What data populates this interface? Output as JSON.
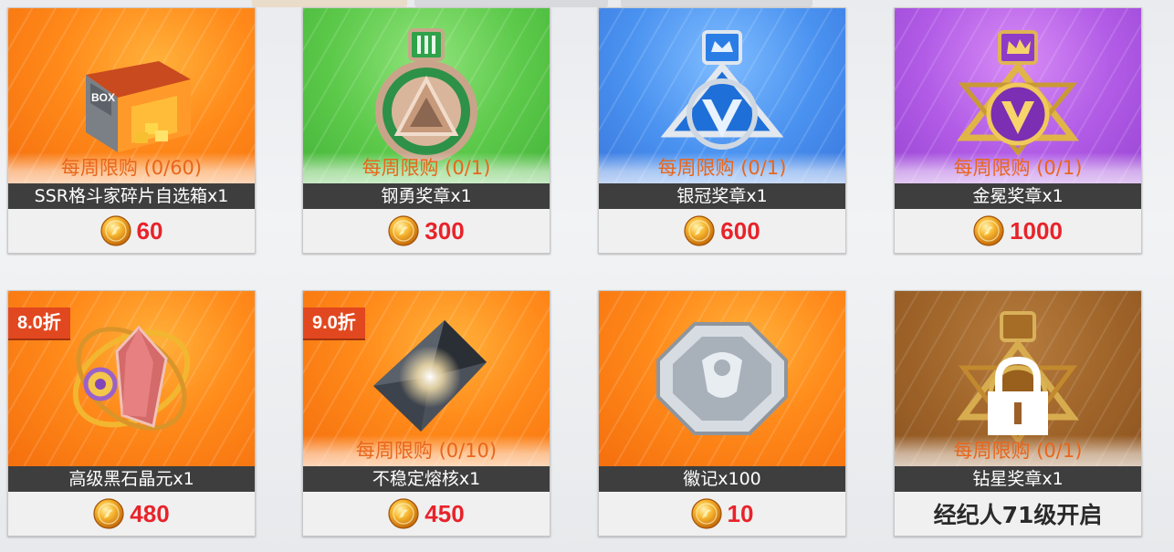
{
  "shop": {
    "items": [
      {
        "name": "SSR格斗家碎片自选箱x1",
        "limit": "每周限购 (0/60)",
        "price": "60",
        "icon": "ssr-fighter-fragment-box-icon",
        "color": "orange"
      },
      {
        "name": "钢勇奖章x1",
        "limit": "每周限购 (0/1)",
        "price": "300",
        "icon": "steel-valor-medal-icon",
        "color": "green"
      },
      {
        "name": "银冠奖章x1",
        "limit": "每周限购 (0/1)",
        "price": "600",
        "icon": "silver-crown-medal-icon",
        "color": "blue"
      },
      {
        "name": "金冕奖章x1",
        "limit": "每周限购 (0/1)",
        "price": "1000",
        "icon": "gold-crown-medal-icon",
        "color": "purple"
      },
      {
        "name": "高级黑石晶元x1",
        "discount": "8.0折",
        "price": "480",
        "icon": "black-stone-crystal-icon",
        "color": "orange"
      },
      {
        "name": "不稳定熔核x1",
        "limit": "每周限购 (0/10)",
        "discount": "9.0折",
        "price": "450",
        "icon": "unstable-core-icon",
        "color": "orange"
      },
      {
        "name": "徽记x100",
        "price": "10",
        "icon": "emblem-icon",
        "color": "orange"
      },
      {
        "name": "钻星奖章x1",
        "limit": "每周限购 (0/1)",
        "locked_text": "经纪人71级开启",
        "icon": "diamond-star-medal-icon",
        "color": "locked"
      }
    ],
    "currency_icon": "gold-coin-icon",
    "colors": {
      "price": "#e8232a",
      "limit": "#e8661c",
      "discount": "#e2481f"
    }
  }
}
